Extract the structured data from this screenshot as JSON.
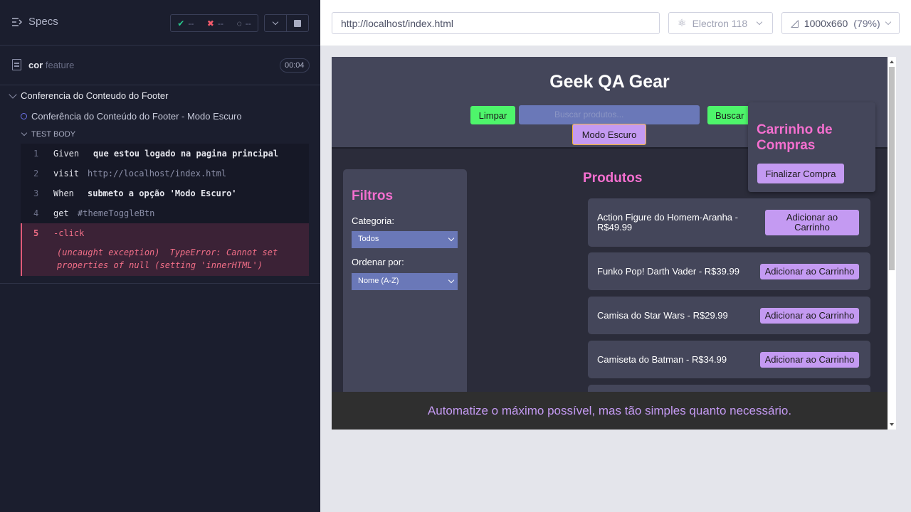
{
  "reporter": {
    "specs_label": "Specs",
    "stats": {
      "passed": "--",
      "failed": "--",
      "pending": "--"
    },
    "spec": {
      "name": "cor",
      "ext": "feature",
      "duration": "00:04"
    },
    "suite_title": "Conferencia do Conteudo do Footer",
    "test_title": "Conferência do Conteúdo do Footer - Modo Escuro",
    "test_body_label": "TEST BODY",
    "commands": [
      {
        "num": "1",
        "keyword": "Given",
        "arg": "que estou logado na pagina principal"
      },
      {
        "num": "2",
        "keyword": "visit",
        "arg": "http://localhost/index.html"
      },
      {
        "num": "3",
        "keyword": "When",
        "arg": "submeto a opção 'Modo Escuro'"
      },
      {
        "num": "4",
        "keyword": "get",
        "arg": "#themeToggleBtn"
      }
    ],
    "failed_command": {
      "num": "5",
      "keyword": "-click",
      "error_prefix": "(uncaught exception)",
      "error_message": "TypeError: Cannot set properties of null (setting 'innerHTML')"
    }
  },
  "aut": {
    "url": "http://localhost/index.html",
    "browser": "Electron 118",
    "viewport_size": "1000x660",
    "viewport_scale": "(79%)"
  },
  "app": {
    "title": "Geek QA Gear",
    "clear_button": "Limpar",
    "search_placeholder": "Buscar produtos...",
    "search_button": "Buscar",
    "dark_mode_button": "Modo Escuro",
    "cart": {
      "title": "Carrinho de Compras",
      "checkout_button": "Finalizar Compra"
    },
    "filters": {
      "title": "Filtros",
      "category_label": "Categoria:",
      "category_value": "Todos",
      "sort_label": "Ordenar por:",
      "sort_value": "Nome (A-Z)"
    },
    "products_title": "Produtos",
    "products": [
      {
        "name": "Action Figure do Homem-Aranha - R$49.99",
        "button": "Adicionar ao Carrinho"
      },
      {
        "name": "Funko Pop! Darth Vader - R$39.99",
        "button": "Adicionar ao Carrinho"
      },
      {
        "name": "Camisa do Star Wars - R$29.99",
        "button": "Adicionar ao Carrinho"
      },
      {
        "name": "Camiseta do Batman - R$34.99",
        "button": "Adicionar ao Carrinho"
      }
    ],
    "footer_text": "Automatize o máximo possível, mas tão simples quanto necessário."
  }
}
